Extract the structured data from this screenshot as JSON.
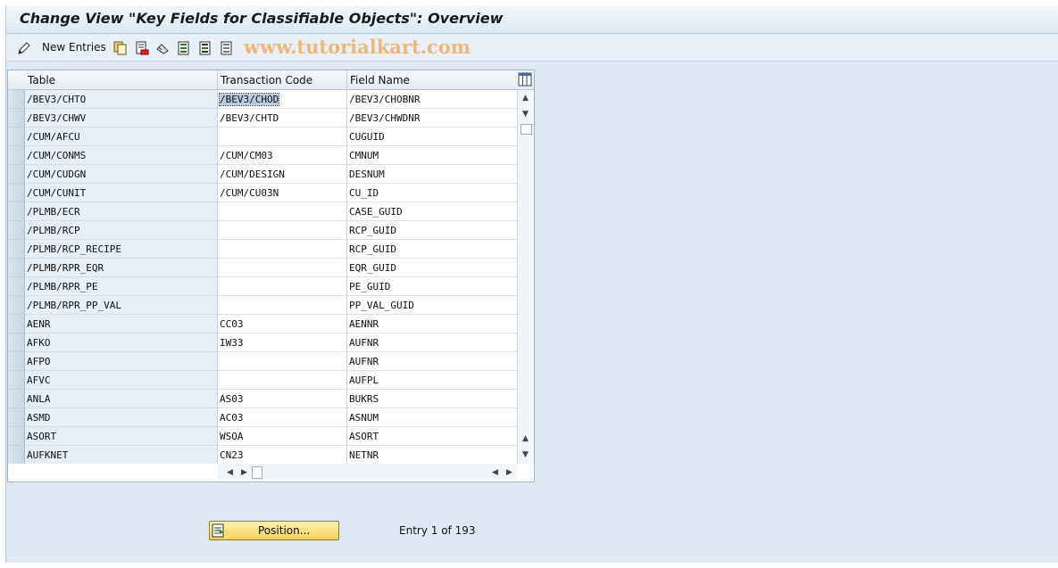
{
  "window": {
    "title": "Change View \"Key Fields for Classifiable Objects\": Overview",
    "watermark": "www.tutorialkart.com"
  },
  "toolbar": {
    "new_entries_label": "New Entries",
    "icons": [
      "edit-pencil-icon",
      "copy-icon",
      "delete-icon",
      "undo-icon",
      "select-all-icon",
      "select-block-icon",
      "deselect-all-icon"
    ]
  },
  "table": {
    "columns": [
      "Table",
      "Transaction Code",
      "Field Name"
    ],
    "rows": [
      {
        "table": "/BEV3/CHTO",
        "tcode": "/BEV3/CHOD",
        "field": "/BEV3/CHOBNR"
      },
      {
        "table": "/BEV3/CHWV",
        "tcode": "/BEV3/CHTD",
        "field": "/BEV3/CHWDNR"
      },
      {
        "table": "/CUM/AFCU",
        "tcode": "",
        "field": "CUGUID"
      },
      {
        "table": "/CUM/CONMS",
        "tcode": "/CUM/CM03",
        "field": "CMNUM"
      },
      {
        "table": "/CUM/CUDGN",
        "tcode": "/CUM/DESIGN",
        "field": "DESNUM"
      },
      {
        "table": "/CUM/CUNIT",
        "tcode": "/CUM/CU03N",
        "field": "CU_ID"
      },
      {
        "table": "/PLMB/ECR",
        "tcode": "",
        "field": "CASE_GUID"
      },
      {
        "table": "/PLMB/RCP",
        "tcode": "",
        "field": "RCP_GUID"
      },
      {
        "table": "/PLMB/RCP_RECIPE",
        "tcode": "",
        "field": "RCP_GUID"
      },
      {
        "table": "/PLMB/RPR_EQR",
        "tcode": "",
        "field": "EQR_GUID"
      },
      {
        "table": "/PLMB/RPR_PE",
        "tcode": "",
        "field": "PE_GUID"
      },
      {
        "table": "/PLMB/RPR_PP_VAL",
        "tcode": "",
        "field": "PP_VAL_GUID"
      },
      {
        "table": "AENR",
        "tcode": "CC03",
        "field": "AENNR"
      },
      {
        "table": "AFKO",
        "tcode": "IW33",
        "field": "AUFNR"
      },
      {
        "table": "AFPO",
        "tcode": "",
        "field": "AUFNR"
      },
      {
        "table": "AFVC",
        "tcode": "",
        "field": "AUFPL"
      },
      {
        "table": "ANLA",
        "tcode": "AS03",
        "field": "BUKRS"
      },
      {
        "table": "ASMD",
        "tcode": "AC03",
        "field": "ASNUM"
      },
      {
        "table": "ASORT",
        "tcode": "WSOA",
        "field": "ASORT"
      },
      {
        "table": "AUFKNET",
        "tcode": "CN23",
        "field": "NETNR"
      }
    ],
    "highlighted_cell": "/BEV3/CHOD"
  },
  "footer": {
    "position_button_label": "Position...",
    "entry_info": "Entry 1 of 193"
  },
  "colors": {
    "frame_bg": "#dfe9f3",
    "key_column_bg": "#e6eef6",
    "button_yellow": "#f2d35b",
    "watermark": "#f0b878"
  }
}
